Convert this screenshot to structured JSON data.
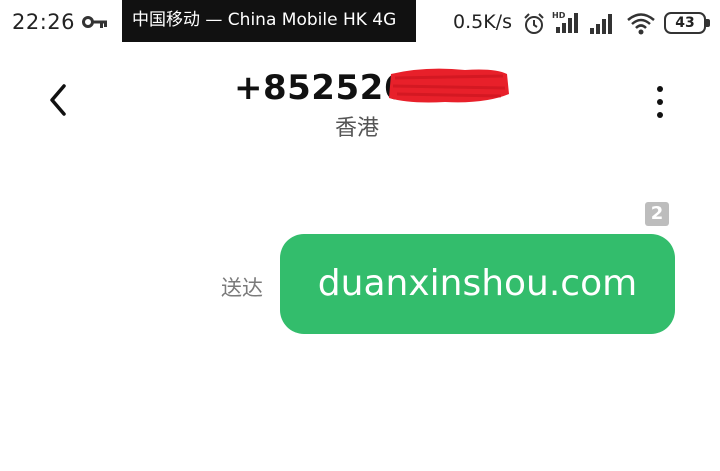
{
  "status_bar": {
    "time": "22:26",
    "carrier": "中国移动 — China Mobile HK 4G",
    "net_speed": "0.5K/s",
    "signal_label": "HD",
    "battery": "43",
    "icons": [
      "key-icon",
      "alarm-icon",
      "signal-icon",
      "wifi-icon",
      "battery-icon"
    ]
  },
  "header": {
    "back_icon": "chevron-left-icon",
    "contact_number": "+852526",
    "contact_region": "香港",
    "more_icon": "more-vertical-icon"
  },
  "message": {
    "sim_slot": "2",
    "status": "送达",
    "text": "duanxinshou.com"
  },
  "colors": {
    "bubble": "#33bd6c",
    "redaction": "#e8202a",
    "carrier_banner_bg": "#111111"
  }
}
